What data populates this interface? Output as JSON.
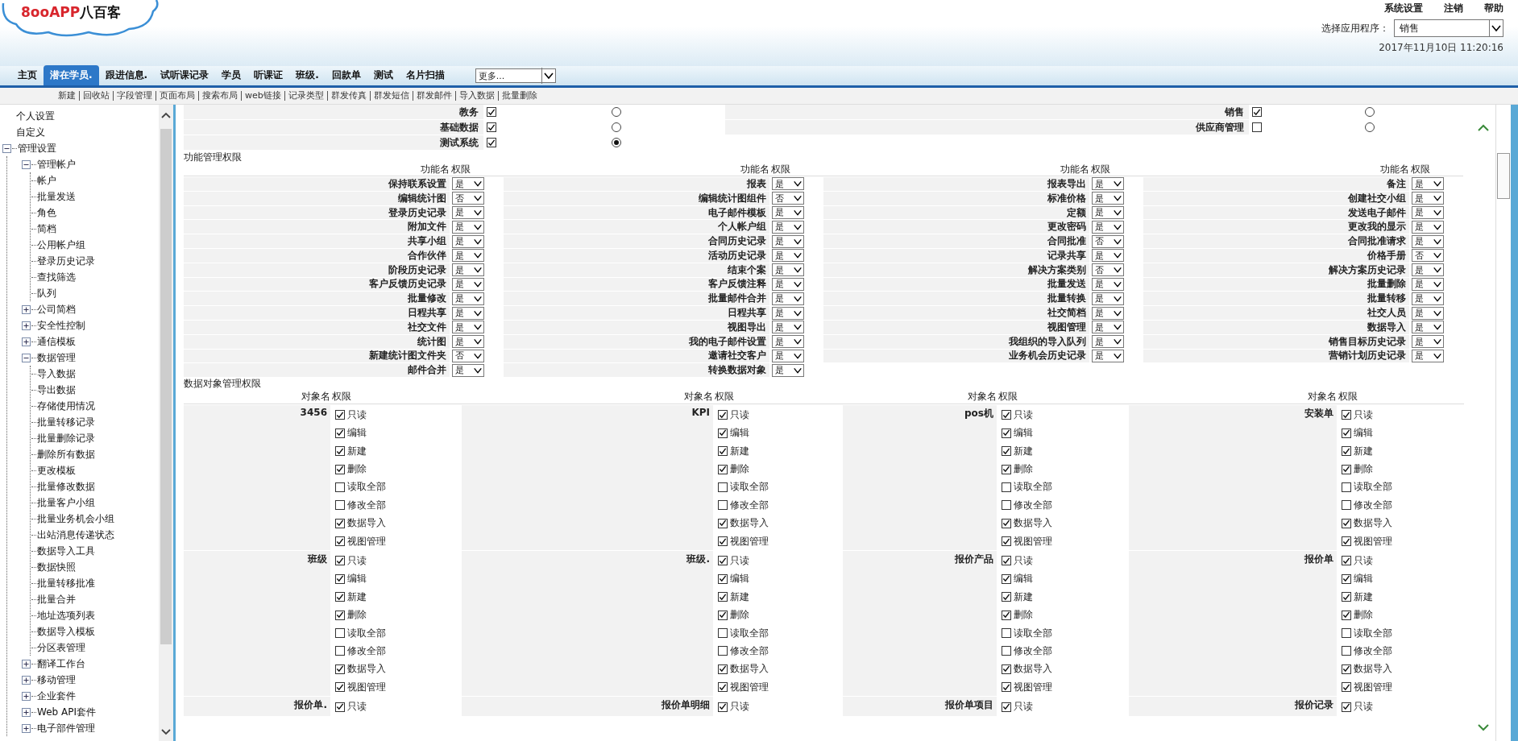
{
  "logo": {
    "latin": "8ooAPP",
    "chinese": "八百客"
  },
  "top_links": [
    "系统设置",
    "注销",
    "帮助"
  ],
  "app_selector": {
    "label": "选择应用程序：",
    "value": "销售"
  },
  "datetime": "2017年11月10日 11:20:16",
  "tabs": [
    {
      "label": "主页",
      "selected": false
    },
    {
      "label": "潜在学员.",
      "selected": true
    },
    {
      "label": "跟进信息.",
      "selected": false
    },
    {
      "label": "试听课记录",
      "selected": false
    },
    {
      "label": "学员",
      "selected": false
    },
    {
      "label": "听课证",
      "selected": false
    },
    {
      "label": "班级.",
      "selected": false
    },
    {
      "label": "回款单",
      "selected": false
    },
    {
      "label": "测试",
      "selected": false
    },
    {
      "label": "名片扫描",
      "selected": false
    }
  ],
  "more_select": {
    "value": "更多..."
  },
  "toolbar_links": [
    "新建",
    "回收站",
    "字段管理",
    "页面布局",
    "搜索布局",
    "web链接",
    "记录类型",
    "群发传真",
    "群发短信",
    "群发邮件",
    "导入数据",
    "批量删除"
  ],
  "sidebar": {
    "items": [
      {
        "label": "个人设置"
      },
      {
        "label": "自定义"
      },
      {
        "label": "管理设置",
        "expanded": true,
        "children": [
          {
            "label": "管理帐户",
            "expanded": true,
            "children": [
              {
                "label": "帐户"
              },
              {
                "label": "批量发送"
              },
              {
                "label": "角色"
              },
              {
                "label": "简档"
              },
              {
                "label": "公用帐户组"
              },
              {
                "label": "登录历史记录"
              },
              {
                "label": "查找筛选"
              },
              {
                "label": "队列"
              }
            ]
          },
          {
            "label": "公司简档",
            "expanded": false
          },
          {
            "label": "安全性控制",
            "expanded": false
          },
          {
            "label": "通信模板",
            "expanded": false
          },
          {
            "label": "数据管理",
            "expanded": true,
            "children": [
              {
                "label": "导入数据"
              },
              {
                "label": "导出数据"
              },
              {
                "label": "存储使用情况"
              },
              {
                "label": "批量转移记录"
              },
              {
                "label": "批量删除记录"
              },
              {
                "label": "删除所有数据"
              },
              {
                "label": "更改模板"
              },
              {
                "label": "批量修改数据"
              },
              {
                "label": "批量客户小组"
              },
              {
                "label": "批量业务机会小组"
              },
              {
                "label": "出站消息传递状态"
              },
              {
                "label": "数据导入工具"
              },
              {
                "label": "数据快照"
              },
              {
                "label": "批量转移批准"
              },
              {
                "label": "批量合并"
              },
              {
                "label": "地址选项列表"
              },
              {
                "label": "数据导入模板"
              },
              {
                "label": "分区表管理"
              }
            ]
          },
          {
            "label": "翻译工作台",
            "expanded": false
          },
          {
            "label": "移动管理",
            "expanded": false
          },
          {
            "label": "企业套件",
            "expanded": false
          },
          {
            "label": "Web API套件",
            "expanded": false
          },
          {
            "label": "电子部件管理",
            "expanded": false
          }
        ]
      }
    ]
  },
  "applications": {
    "columns": [
      [
        {
          "name": "教务",
          "checked": true,
          "selected": false
        },
        {
          "name": "基础数据",
          "checked": true,
          "selected": false
        },
        {
          "name": "测试系统",
          "checked": true,
          "selected": true
        }
      ],
      [
        {
          "name": "销售",
          "checked": true,
          "selected": false
        },
        {
          "name": "供应商管理",
          "checked": false,
          "selected": false
        }
      ]
    ]
  },
  "function_permissions": {
    "title": "功能管理权限",
    "columns": [
      {
        "name_header": "功能名",
        "value_header": "权限",
        "items": [
          {
            "name": "保持联系设置",
            "value": "是"
          },
          {
            "name": "编辑统计图",
            "value": "否"
          },
          {
            "name": "登录历史记录",
            "value": "是"
          },
          {
            "name": "附加文件",
            "value": "是"
          },
          {
            "name": "共享小组",
            "value": "是"
          },
          {
            "name": "合作伙伴",
            "value": "是"
          },
          {
            "name": "阶段历史记录",
            "value": "是"
          },
          {
            "name": "客户反馈历史记录",
            "value": "是"
          },
          {
            "name": "批量修改",
            "value": "是"
          },
          {
            "name": "日程共享",
            "value": "是"
          },
          {
            "name": "社交文件",
            "value": "是"
          },
          {
            "name": "统计图",
            "value": "是"
          },
          {
            "name": "新建统计图文件夹",
            "value": "否"
          },
          {
            "name": "邮件合并",
            "value": "是"
          }
        ]
      },
      {
        "name_header": "功能名",
        "value_header": "权限",
        "items": [
          {
            "name": "报表",
            "value": "是"
          },
          {
            "name": "编辑统计图组件",
            "value": "否"
          },
          {
            "name": "电子邮件模板",
            "value": "是"
          },
          {
            "name": "个人帐户组",
            "value": "是"
          },
          {
            "name": "合同历史记录",
            "value": "是"
          },
          {
            "name": "活动历史记录",
            "value": "是"
          },
          {
            "name": "结束个案",
            "value": "是"
          },
          {
            "name": "客户反馈注释",
            "value": "是"
          },
          {
            "name": "批量邮件合并",
            "value": "是"
          },
          {
            "name": "日程共享",
            "value": "是"
          },
          {
            "name": "视图导出",
            "value": "是"
          },
          {
            "name": "我的电子邮件设置",
            "value": "是"
          },
          {
            "name": "邀请社交客户",
            "value": "是"
          },
          {
            "name": "转换数据对象",
            "value": "是"
          }
        ]
      },
      {
        "name_header": "功能名",
        "value_header": "权限",
        "items": [
          {
            "name": "报表导出",
            "value": "是"
          },
          {
            "name": "标准价格",
            "value": "是"
          },
          {
            "name": "定额",
            "value": "是"
          },
          {
            "name": "更改密码",
            "value": "是"
          },
          {
            "name": "合同批准",
            "value": "否"
          },
          {
            "name": "记录共享",
            "value": "是"
          },
          {
            "name": "解决方案类别",
            "value": "否"
          },
          {
            "name": "批量发送",
            "value": "是"
          },
          {
            "name": "批量转换",
            "value": "是"
          },
          {
            "name": "社交简档",
            "value": "是"
          },
          {
            "name": "视图管理",
            "value": "是"
          },
          {
            "name": "我组织的导入队列",
            "value": "是"
          },
          {
            "name": "业务机会历史记录",
            "value": "是"
          }
        ]
      },
      {
        "name_header": "功能名",
        "value_header": "权限",
        "items": [
          {
            "name": "备注",
            "value": "是"
          },
          {
            "name": "创建社交小组",
            "value": "是"
          },
          {
            "name": "发送电子邮件",
            "value": "是"
          },
          {
            "name": "更改我的显示",
            "value": "是"
          },
          {
            "name": "合同批准请求",
            "value": "是"
          },
          {
            "name": "价格手册",
            "value": "否"
          },
          {
            "name": "解决方案历史记录",
            "value": "是"
          },
          {
            "name": "批量删除",
            "value": "是"
          },
          {
            "name": "批量转移",
            "value": "是"
          },
          {
            "name": "社交人员",
            "value": "是"
          },
          {
            "name": "数据导入",
            "value": "是"
          },
          {
            "name": "销售目标历史记录",
            "value": "是"
          },
          {
            "name": "营销计划历史记录",
            "value": "是"
          }
        ]
      }
    ]
  },
  "object_permissions": {
    "title": "数据对象管理权限",
    "headers": [
      {
        "name_header": "对象名",
        "value_header": "权限"
      },
      {
        "name_header": "对象名",
        "value_header": "权限"
      },
      {
        "name_header": "对象名",
        "value_header": "权限"
      },
      {
        "name_header": "对象名",
        "value_header": "权限"
      }
    ],
    "objects": [
      {
        "name": "3456",
        "permissions": [
          {
            "label": "只读",
            "checked": true
          },
          {
            "label": "编辑",
            "checked": true
          },
          {
            "label": "新建",
            "checked": true
          },
          {
            "label": "删除",
            "checked": true
          },
          {
            "label": "读取全部",
            "checked": false
          },
          {
            "label": "修改全部",
            "checked": false
          },
          {
            "label": "数据导入",
            "checked": true
          },
          {
            "label": "视图管理",
            "checked": true
          }
        ]
      },
      {
        "name": "KPI",
        "permissions": [
          {
            "label": "只读",
            "checked": true
          },
          {
            "label": "编辑",
            "checked": true
          },
          {
            "label": "新建",
            "checked": true
          },
          {
            "label": "删除",
            "checked": true
          },
          {
            "label": "读取全部",
            "checked": false
          },
          {
            "label": "修改全部",
            "checked": false
          },
          {
            "label": "数据导入",
            "checked": true
          },
          {
            "label": "视图管理",
            "checked": true
          }
        ]
      },
      {
        "name": "pos机",
        "permissions": [
          {
            "label": "只读",
            "checked": true
          },
          {
            "label": "编辑",
            "checked": true
          },
          {
            "label": "新建",
            "checked": true
          },
          {
            "label": "删除",
            "checked": true
          },
          {
            "label": "读取全部",
            "checked": false
          },
          {
            "label": "修改全部",
            "checked": false
          },
          {
            "label": "数据导入",
            "checked": true
          },
          {
            "label": "视图管理",
            "checked": true
          }
        ]
      },
      {
        "name": "安装单",
        "permissions": [
          {
            "label": "只读",
            "checked": true
          },
          {
            "label": "编辑",
            "checked": true
          },
          {
            "label": "新建",
            "checked": true
          },
          {
            "label": "删除",
            "checked": true
          },
          {
            "label": "读取全部",
            "checked": false
          },
          {
            "label": "修改全部",
            "checked": false
          },
          {
            "label": "数据导入",
            "checked": true
          },
          {
            "label": "视图管理",
            "checked": true
          }
        ]
      },
      {
        "name": "班级",
        "permissions": [
          {
            "label": "只读",
            "checked": true
          },
          {
            "label": "编辑",
            "checked": true
          },
          {
            "label": "新建",
            "checked": true
          },
          {
            "label": "删除",
            "checked": true
          },
          {
            "label": "读取全部",
            "checked": false
          },
          {
            "label": "修改全部",
            "checked": false
          },
          {
            "label": "数据导入",
            "checked": true
          },
          {
            "label": "视图管理",
            "checked": true
          }
        ]
      },
      {
        "name": "班级.",
        "permissions": [
          {
            "label": "只读",
            "checked": true
          },
          {
            "label": "编辑",
            "checked": true
          },
          {
            "label": "新建",
            "checked": true
          },
          {
            "label": "删除",
            "checked": true
          },
          {
            "label": "读取全部",
            "checked": false
          },
          {
            "label": "修改全部",
            "checked": false
          },
          {
            "label": "数据导入",
            "checked": true
          },
          {
            "label": "视图管理",
            "checked": true
          }
        ]
      },
      {
        "name": "报价产品",
        "permissions": [
          {
            "label": "只读",
            "checked": true
          },
          {
            "label": "编辑",
            "checked": true
          },
          {
            "label": "新建",
            "checked": true
          },
          {
            "label": "删除",
            "checked": true
          },
          {
            "label": "读取全部",
            "checked": false
          },
          {
            "label": "修改全部",
            "checked": false
          },
          {
            "label": "数据导入",
            "checked": true
          },
          {
            "label": "视图管理",
            "checked": true
          }
        ]
      },
      {
        "name": "报价单",
        "permissions": [
          {
            "label": "只读",
            "checked": true
          },
          {
            "label": "编辑",
            "checked": true
          },
          {
            "label": "新建",
            "checked": true
          },
          {
            "label": "删除",
            "checked": true
          },
          {
            "label": "读取全部",
            "checked": false
          },
          {
            "label": "修改全部",
            "checked": false
          },
          {
            "label": "数据导入",
            "checked": true
          },
          {
            "label": "视图管理",
            "checked": true
          }
        ]
      },
      {
        "name": "报价单.",
        "permissions": [
          {
            "label": "只读",
            "checked": true
          }
        ]
      },
      {
        "name": "报价单明细",
        "permissions": [
          {
            "label": "只读",
            "checked": true
          }
        ]
      },
      {
        "name": "报价单项目",
        "permissions": [
          {
            "label": "只读",
            "checked": true
          }
        ]
      },
      {
        "name": "报价记录",
        "permissions": [
          {
            "label": "只读",
            "checked": true
          }
        ]
      }
    ]
  }
}
